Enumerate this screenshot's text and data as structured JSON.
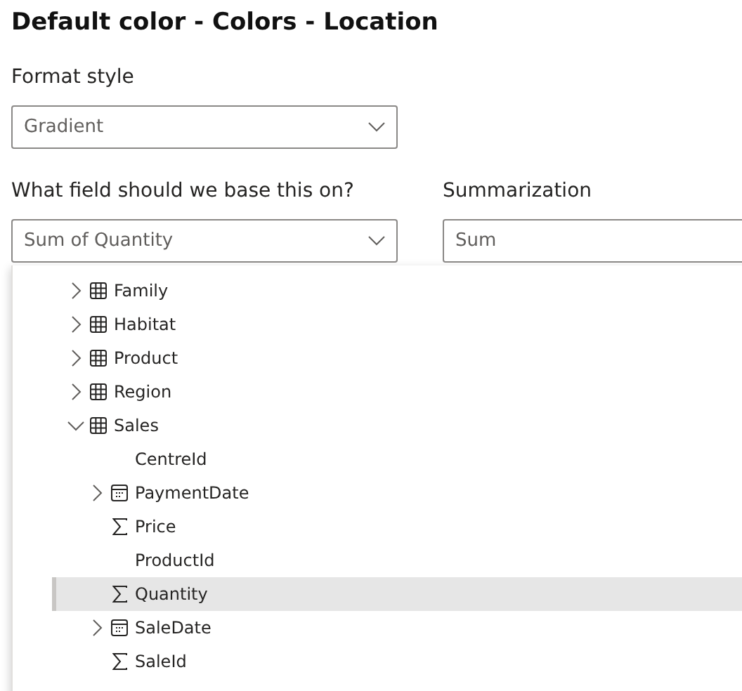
{
  "title": "Default color - Colors - Location",
  "format_style": {
    "label": "Format style",
    "value": "Gradient"
  },
  "base_field": {
    "label": "What field should we base this on?",
    "value": "Sum of Quantity"
  },
  "summarization": {
    "label": "Summarization",
    "value": "Sum"
  },
  "tree": [
    {
      "label": "Family",
      "kind": "table",
      "expanded": false,
      "selected": false
    },
    {
      "label": "Habitat",
      "kind": "table",
      "expanded": false,
      "selected": false
    },
    {
      "label": "Product",
      "kind": "table",
      "expanded": false,
      "selected": false
    },
    {
      "label": "Region",
      "kind": "table",
      "expanded": false,
      "selected": false
    },
    {
      "label": "Sales",
      "kind": "table",
      "expanded": true,
      "selected": false,
      "children": [
        {
          "label": "CentreId",
          "kind": "plain",
          "selected": false
        },
        {
          "label": "PaymentDate",
          "kind": "date",
          "expanded": false,
          "selected": false
        },
        {
          "label": "Price",
          "kind": "measure",
          "selected": false
        },
        {
          "label": "ProductId",
          "kind": "plain",
          "selected": false
        },
        {
          "label": "Quantity",
          "kind": "measure",
          "selected": true
        },
        {
          "label": "SaleDate",
          "kind": "date",
          "expanded": false,
          "selected": false
        },
        {
          "label": "SaleId",
          "kind": "measure",
          "selected": false
        }
      ]
    }
  ]
}
